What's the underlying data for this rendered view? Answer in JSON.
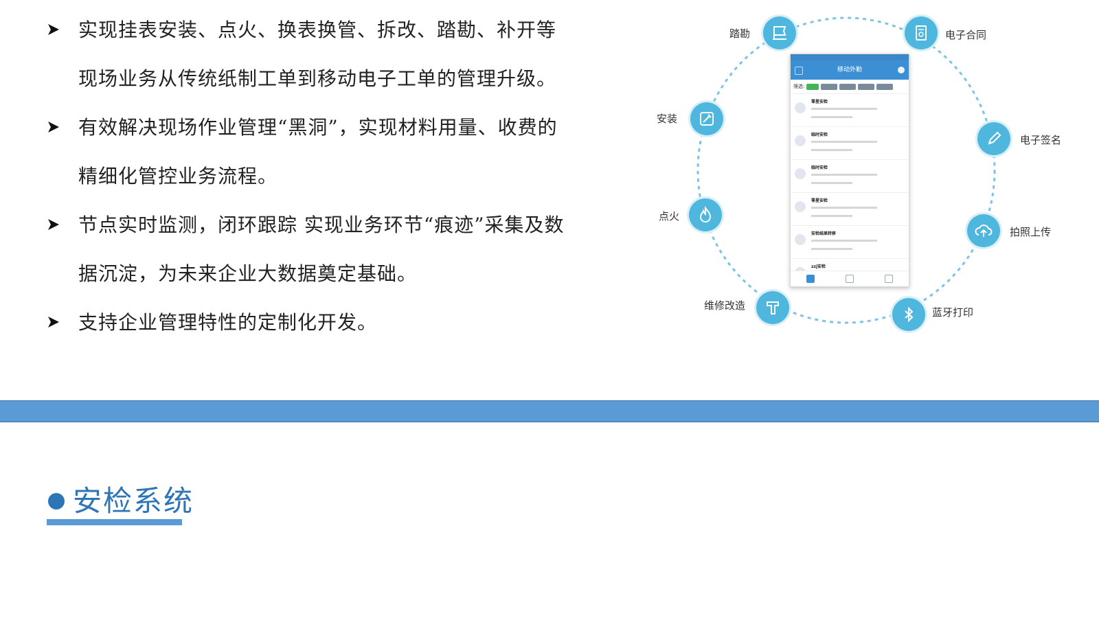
{
  "bullets": [
    {
      "line1": "实现挂表安装、点火、换表换管、拆改、踏勘、补开等",
      "line2": "现场业务从传统纸制工单到移动电子工单的管理升级。"
    },
    {
      "line1": "有效解决现场作业管理“黑洞”，实现材料用量、收费的",
      "line2": "精细化管控业务流程。"
    },
    {
      "line1": "节点实时监测，闭环跟踪 实现业务环节“痕迹”采集及数",
      "line2": "据沉淀，为未来企业大数据奠定基础。"
    },
    {
      "line1": "支持企业管理特性的定制化开发。",
      "line2": ""
    }
  ],
  "diagram": {
    "nodes": [
      {
        "label": "踏勘",
        "icon": "flag-icon"
      },
      {
        "label": "电子合同",
        "icon": "contract-icon"
      },
      {
        "label": "安装",
        "icon": "wrench-icon"
      },
      {
        "label": "电子签名",
        "icon": "pen-icon"
      },
      {
        "label": "点火",
        "icon": "flame-icon"
      },
      {
        "label": "拍照上传",
        "icon": "cloud-upload-icon"
      },
      {
        "label": "维修改造",
        "icon": "hammer-icon"
      },
      {
        "label": "蓝牙打印",
        "icon": "bluetooth-icon"
      }
    ],
    "phone": {
      "title": "移动外勤",
      "filter_label": "筛选:",
      "items": [
        "零星安检",
        "临时安检",
        "临时安检",
        "零星安检",
        "安检结果转移",
        "zzj安检"
      ]
    },
    "accent": "#4fb6dd"
  },
  "section": {
    "title": "安检系统",
    "color": "#2e75b6"
  },
  "band_color": "#5b9bd5"
}
